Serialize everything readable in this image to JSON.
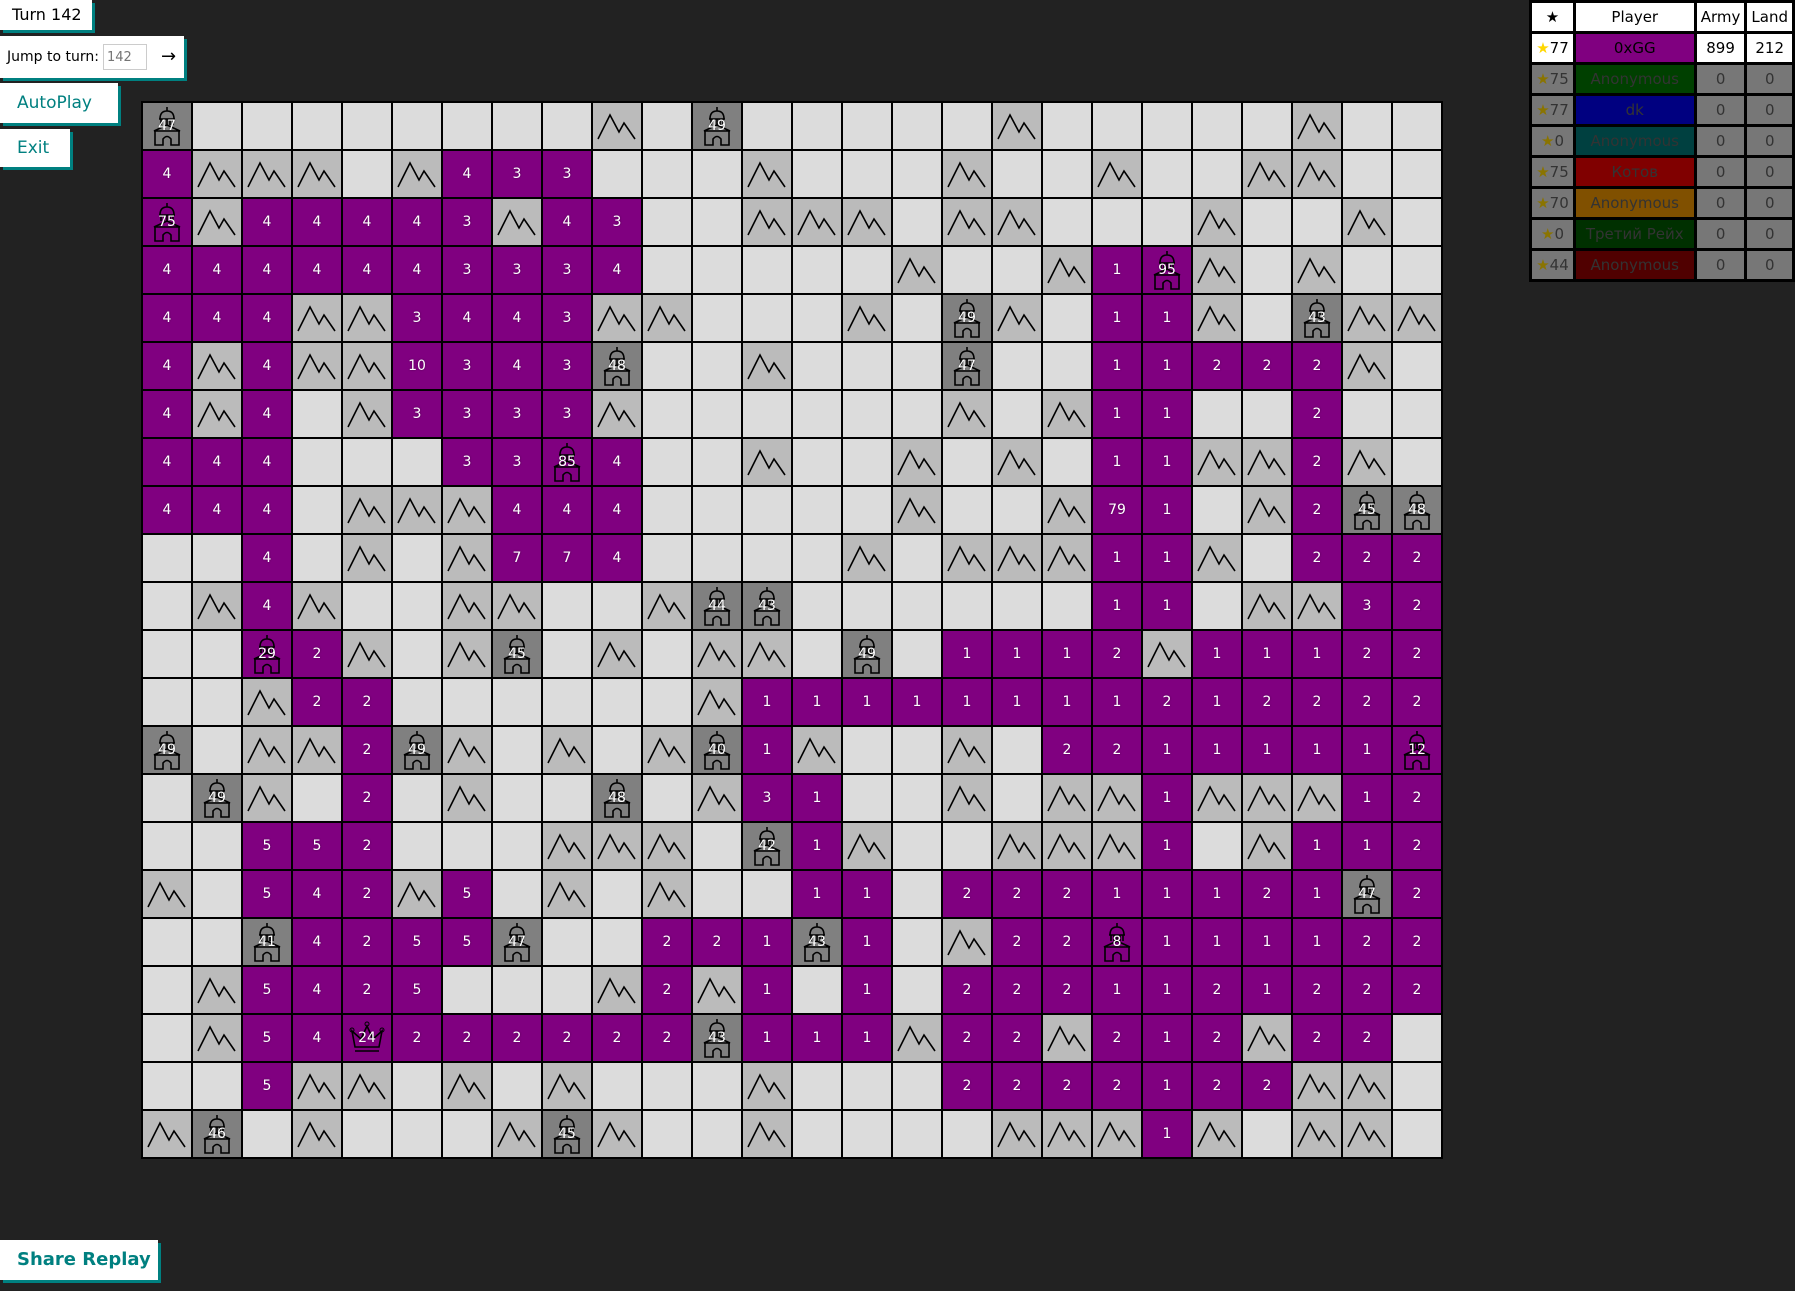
{
  "controls": {
    "turn_label": "Turn 142",
    "jump_label": "Jump to turn:",
    "jump_placeholder": "142",
    "jump_go": "→",
    "autoplay_label": "AutoPlay",
    "exit_label": "Exit",
    "share_label": "Share Replay"
  },
  "leaderboard": {
    "headers": {
      "star": "★",
      "player": "Player",
      "army": "Army",
      "land": "Land"
    },
    "rows": [
      {
        "stars": "77",
        "name": "0xGG",
        "color": "#800080",
        "army": "899",
        "land": "212",
        "alive": true,
        "serif": false
      },
      {
        "stars": "75",
        "name": "Anonymous",
        "color": "#004000",
        "army": "0",
        "land": "0",
        "alive": false,
        "serif": false
      },
      {
        "stars": "77",
        "name": "dk",
        "color": "#000080",
        "army": "0",
        "land": "0",
        "alive": false,
        "serif": false
      },
      {
        "stars": "0",
        "name": "Anonymous",
        "color": "#004040",
        "army": "0",
        "land": "0",
        "alive": false,
        "serif": false
      },
      {
        "stars": "75",
        "name": "Котов",
        "color": "#800000",
        "army": "0",
        "land": "0",
        "alive": false,
        "serif": true
      },
      {
        "stars": "70",
        "name": "Anonymous",
        "color": "#805000",
        "army": "0",
        "land": "0",
        "alive": false,
        "serif": false
      },
      {
        "stars": "0",
        "name": "Третий Рейх",
        "color": "#003000",
        "army": "0",
        "land": "0",
        "alive": false,
        "serif": true
      },
      {
        "stars": "44",
        "name": "Anonymous",
        "color": "#500000",
        "army": "0",
        "land": "0",
        "alive": false,
        "serif": false
      }
    ]
  },
  "map": {
    "legend": {
      "E": "empty",
      "M": "mountain",
      "C": "neutral city",
      "P": "player tile (0xGG)",
      "PC": "player city",
      "K": "player general (crown)"
    },
    "player_color": "#800080",
    "rows": [
      [
        "C47",
        "E",
        "E",
        "E",
        "E",
        "E",
        "E",
        "E",
        "E",
        "M",
        "E",
        "C49",
        "E",
        "E",
        "E",
        "E",
        "E",
        "M",
        "E",
        "E",
        "E",
        "E",
        "E",
        "M",
        "E",
        "E"
      ],
      [
        "P4",
        "M",
        "M",
        "M",
        "E",
        "M",
        "P4",
        "P3",
        "P3",
        "E",
        "E",
        "E",
        "M",
        "E",
        "E",
        "E",
        "M",
        "E",
        "E",
        "M",
        "E",
        "E",
        "M",
        "M",
        "E",
        "E"
      ],
      [
        "PC75",
        "M",
        "P4",
        "P4",
        "P4",
        "P4",
        "P3",
        "M",
        "P4",
        "P3",
        "E",
        "E",
        "M",
        "M",
        "M",
        "E",
        "M",
        "M",
        "E",
        "E",
        "E",
        "M",
        "E",
        "E",
        "M",
        "E"
      ],
      [
        "P4",
        "P4",
        "P4",
        "P4",
        "P4",
        "P4",
        "P3",
        "P3",
        "P3",
        "P4",
        "E",
        "E",
        "E",
        "E",
        "E",
        "M",
        "E",
        "E",
        "M",
        "P1",
        "PC95",
        "M",
        "E",
        "M",
        "E",
        "E"
      ],
      [
        "P4",
        "P4",
        "P4",
        "M",
        "M",
        "P3",
        "P4",
        "P4",
        "P3",
        "M",
        "M",
        "E",
        "E",
        "E",
        "M",
        "E",
        "C49",
        "M",
        "E",
        "P1",
        "P1",
        "M",
        "E",
        "C43",
        "M",
        "M"
      ],
      [
        "P4",
        "M",
        "P4",
        "M",
        "M",
        "P10",
        "P3",
        "P4",
        "P3",
        "C48",
        "E",
        "E",
        "M",
        "E",
        "E",
        "E",
        "C47",
        "E",
        "E",
        "P1",
        "P1",
        "P2",
        "P2",
        "P2",
        "M",
        "E"
      ],
      [
        "P4",
        "M",
        "P4",
        "E",
        "M",
        "P3",
        "P3",
        "P3",
        "P3",
        "M",
        "E",
        "E",
        "E",
        "E",
        "E",
        "E",
        "M",
        "E",
        "M",
        "P1",
        "P1",
        "E",
        "E",
        "P2",
        "E",
        "E"
      ],
      [
        "P4",
        "P4",
        "P4",
        "E",
        "E",
        "E",
        "P3",
        "P3",
        "PC85",
        "P4",
        "E",
        "E",
        "M",
        "E",
        "E",
        "M",
        "E",
        "M",
        "E",
        "P1",
        "P1",
        "M",
        "M",
        "P2",
        "M",
        "E"
      ],
      [
        "P4",
        "P4",
        "P4",
        "E",
        "M",
        "M",
        "M",
        "P4",
        "P4",
        "P4",
        "E",
        "E",
        "E",
        "E",
        "E",
        "M",
        "E",
        "E",
        "M",
        "P79",
        "P1",
        "E",
        "M",
        "P2",
        "C45",
        "C48"
      ],
      [
        "E",
        "E",
        "P4",
        "E",
        "M",
        "E",
        "M",
        "P7",
        "P7",
        "P4",
        "E",
        "E",
        "E",
        "E",
        "M",
        "E",
        "M",
        "M",
        "M",
        "P1",
        "P1",
        "M",
        "E",
        "P2",
        "P2",
        "P2"
      ],
      [
        "E",
        "M",
        "P4",
        "M",
        "E",
        "E",
        "M",
        "M",
        "E",
        "E",
        "M",
        "C44",
        "C43",
        "E",
        "E",
        "E",
        "E",
        "E",
        "E",
        "P1",
        "P1",
        "E",
        "M",
        "M",
        "P3",
        "P2"
      ],
      [
        "E",
        "E",
        "PC29",
        "P2",
        "M",
        "E",
        "M",
        "C45",
        "E",
        "M",
        "E",
        "M",
        "M",
        "E",
        "C49",
        "E",
        "P1",
        "P1",
        "P1",
        "P2",
        "M",
        "P1",
        "P1",
        "P1",
        "P2",
        "P2"
      ],
      [
        "E",
        "E",
        "M",
        "P2",
        "P2",
        "E",
        "E",
        "E",
        "E",
        "E",
        "E",
        "M",
        "P1",
        "P1",
        "P1",
        "P1",
        "P1",
        "P1",
        "P1",
        "P1",
        "P2",
        "P1",
        "P2",
        "P2",
        "P2",
        "P2"
      ],
      [
        "C49",
        "E",
        "M",
        "M",
        "P2",
        "C49",
        "M",
        "E",
        "M",
        "E",
        "M",
        "C40",
        "P1",
        "M",
        "E",
        "E",
        "M",
        "E",
        "P2",
        "P2",
        "P1",
        "P1",
        "P1",
        "P1",
        "P1",
        "PC12"
      ],
      [
        "E",
        "C49",
        "M",
        "E",
        "P2",
        "E",
        "M",
        "E",
        "E",
        "C48",
        "E",
        "M",
        "P3",
        "P1",
        "E",
        "E",
        "M",
        "E",
        "M",
        "M",
        "P1",
        "M",
        "M",
        "M",
        "P1",
        "P2"
      ],
      [
        "E",
        "E",
        "P5",
        "P5",
        "P2",
        "E",
        "E",
        "E",
        "M",
        "M",
        "M",
        "E",
        "C42",
        "P1",
        "M",
        "E",
        "E",
        "M",
        "M",
        "M",
        "P1",
        "E",
        "M",
        "P1",
        "P1",
        "P2"
      ],
      [
        "M",
        "E",
        "P5",
        "P4",
        "P2",
        "M",
        "P5",
        "E",
        "M",
        "E",
        "M",
        "E",
        "E",
        "P1",
        "P1",
        "E",
        "P2",
        "P2",
        "P2",
        "P1",
        "P1",
        "P1",
        "P2",
        "P1",
        "C47",
        "P2"
      ],
      [
        "E",
        "E",
        "C41",
        "P4",
        "P2",
        "P5",
        "P5",
        "C47",
        "E",
        "E",
        "P2",
        "P2",
        "P1",
        "C43",
        "P1",
        "E",
        "M",
        "P2",
        "P2",
        "PC8",
        "P1",
        "P1",
        "P1",
        "P1",
        "P2",
        "P2"
      ],
      [
        "E",
        "M",
        "P5",
        "P4",
        "P2",
        "P5",
        "E",
        "E",
        "E",
        "M",
        "P2",
        "M",
        "P1",
        "E",
        "P1",
        "E",
        "P2",
        "P2",
        "P2",
        "P1",
        "P1",
        "P2",
        "P1",
        "P2",
        "P2",
        "P2"
      ],
      [
        "E",
        "M",
        "P5",
        "P4",
        "K24",
        "P2",
        "P2",
        "P2",
        "P2",
        "P2",
        "P2",
        "C43",
        "P1",
        "P1",
        "P1",
        "M",
        "P2",
        "P2",
        "M",
        "P2",
        "P1",
        "P2",
        "M",
        "P2",
        "P2",
        "E"
      ],
      [
        "E",
        "E",
        "P5",
        "M",
        "M",
        "E",
        "M",
        "E",
        "M",
        "E",
        "E",
        "E",
        "M",
        "E",
        "E",
        "E",
        "P2",
        "P2",
        "P2",
        "P2",
        "P1",
        "P2",
        "P2",
        "M",
        "M",
        "E"
      ],
      [
        "M",
        "C46",
        "E",
        "M",
        "E",
        "E",
        "E",
        "M",
        "C45",
        "M",
        "E",
        "E",
        "M",
        "E",
        "E",
        "E",
        "E",
        "M",
        "M",
        "M",
        "P1",
        "M",
        "E",
        "M",
        "M",
        "E"
      ]
    ]
  }
}
